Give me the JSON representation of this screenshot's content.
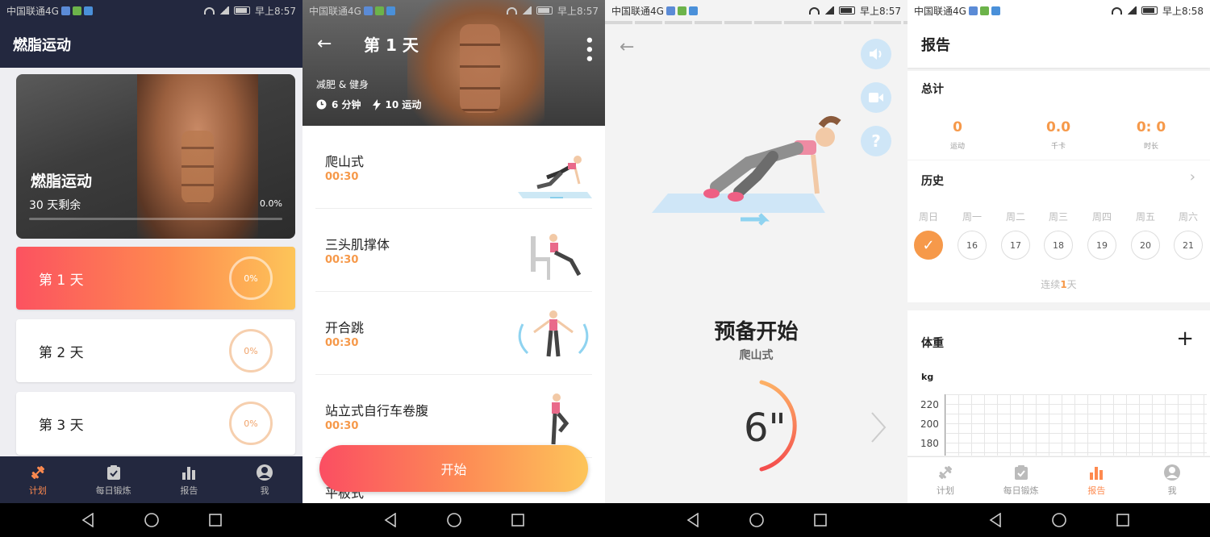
{
  "status_bars": [
    {
      "carrier": "中国联通4G",
      "time": "早上8:57"
    },
    {
      "carrier": "中国联通4G",
      "time": "早上8:57"
    },
    {
      "carrier": "中国联通4G",
      "time": "早上8:57"
    },
    {
      "carrier": "中国联通4G",
      "time": "早上8:58"
    }
  ],
  "plan_screen": {
    "title": "燃脂运动",
    "hero": {
      "title": "燃脂运动",
      "days_left": "30 天剩余",
      "progress_label": "0.0%",
      "progress": 0.0
    },
    "days": [
      {
        "label": "第 1 天",
        "percent": "0%",
        "active": true
      },
      {
        "label": "第 2 天",
        "percent": "0%",
        "active": false
      },
      {
        "label": "第 3 天",
        "percent": "0%",
        "active": false
      }
    ]
  },
  "tabs": [
    {
      "label": "计划",
      "icon": "dumbbell-icon"
    },
    {
      "label": "每日锻炼",
      "icon": "clipboard-check-icon"
    },
    {
      "label": "报告",
      "icon": "bar-chart-icon"
    },
    {
      "label": "我",
      "icon": "user-icon"
    }
  ],
  "day_screen": {
    "title": "第 1 天",
    "category": "减肥 & 健身",
    "duration": "6 分钟",
    "exercise_count": "10 运动",
    "exercises": [
      {
        "name": "爬山式",
        "duration": "00:30"
      },
      {
        "name": "三头肌撑体",
        "duration": "00:30"
      },
      {
        "name": "开合跳",
        "duration": "00:30"
      },
      {
        "name": "站立式自行车卷腹",
        "duration": "00:30"
      },
      {
        "name": "平板式",
        "duration": ""
      }
    ],
    "start_label": "开始"
  },
  "ready_screen": {
    "ready_label": "预备开始",
    "exercise_name": "爬山式",
    "countdown": "6\"",
    "side_icons": [
      "volume-icon",
      "video-icon",
      "help-icon"
    ]
  },
  "report_screen": {
    "title": "报告",
    "totals_title": "总计",
    "totals": [
      {
        "value": "0",
        "label": "运动"
      },
      {
        "value": "0.0",
        "label": "千卡"
      },
      {
        "value": "0: 0",
        "label": "时长"
      }
    ],
    "history_title": "历史",
    "weekdays": [
      "周日",
      "周一",
      "周二",
      "周三",
      "周四",
      "周五",
      "周六"
    ],
    "dates": [
      "✓",
      "16",
      "17",
      "18",
      "19",
      "20",
      "21"
    ],
    "streak_prefix": "连续",
    "streak_count": "1",
    "streak_suffix": "天",
    "weight_title": "体重",
    "weight_unit": "kg",
    "weight_ticks": [
      "220",
      "200",
      "180"
    ]
  },
  "colors": {
    "accent": "#f6994a",
    "dark_bg": "#23283f",
    "gradient_start": "#fc5260",
    "gradient_end": "#fdc559"
  }
}
